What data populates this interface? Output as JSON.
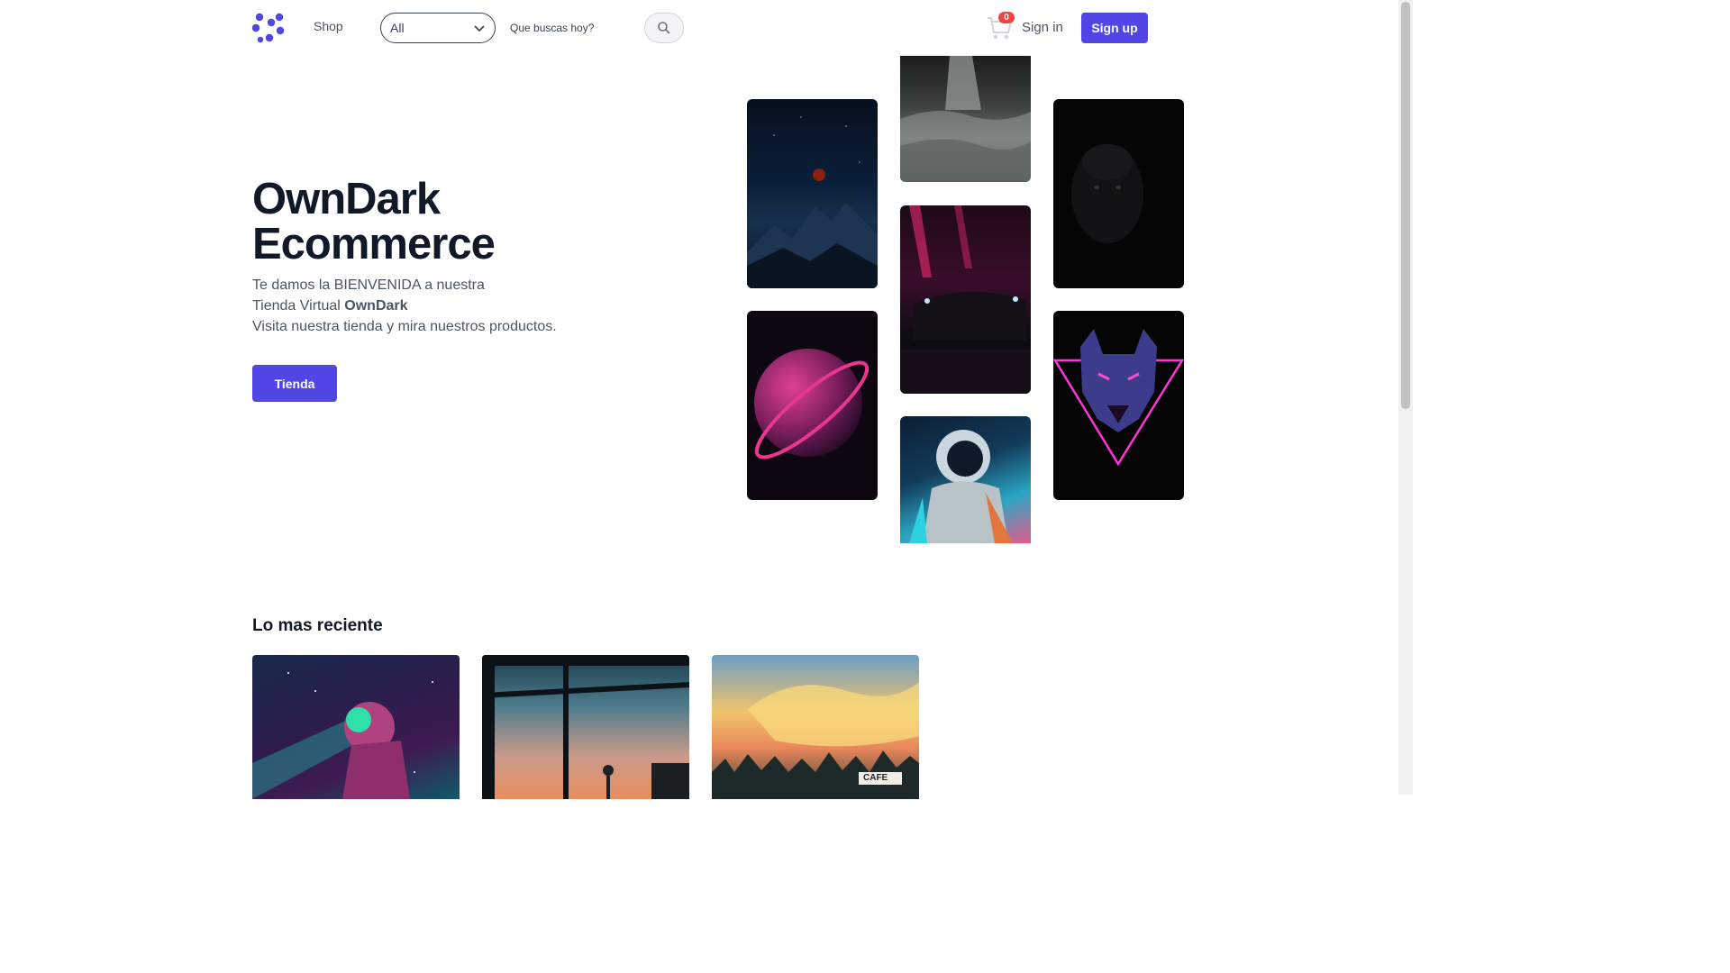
{
  "header": {
    "nav_shop": "Shop",
    "category_selected": "All",
    "search_placeholder": "Que buscas hoy?",
    "cart_count": "0",
    "signin_label": "Sign in",
    "signup_label": "Sign up"
  },
  "hero": {
    "title_line1": "OwnDark",
    "title_line2": "Ecommerce",
    "text_line1": "Te damos la BIENVENIDA a nuestra",
    "text_line2_prefix": "Tienda Virtual ",
    "text_line2_bold": "OwnDark",
    "text_line3": "Visita nuestra tienda y mira nuestros productos.",
    "cta_label": "Tienda"
  },
  "recent": {
    "title": "Lo mas reciente",
    "cafe_sign": "CAFE"
  },
  "colors": {
    "accent": "#4f46e5",
    "badge": "#ef4444"
  },
  "icons": {
    "logo": "brand-logo-icon",
    "chevron": "chevron-down-icon",
    "search": "search-icon",
    "cart": "cart-icon"
  }
}
